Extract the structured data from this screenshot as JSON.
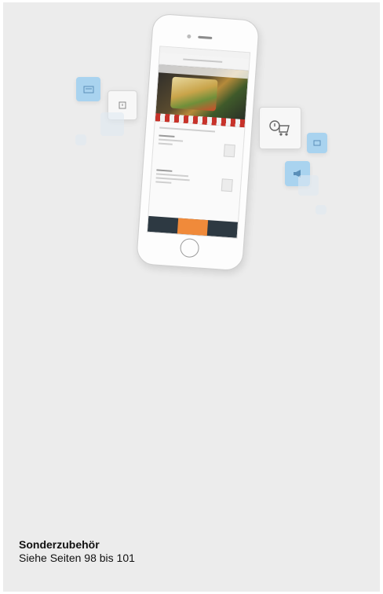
{
  "caption": {
    "title": "Sonderzubehör",
    "subtitle": "Siehe Seiten 98 bis 101"
  },
  "colors": {
    "page_bg": "#ececec",
    "tile_blue": "#a9d3ef",
    "tab_active": "#f08a3a",
    "tab_bar": "#2d3942"
  },
  "icons": [
    "oven-icon",
    "timer-icon",
    "cart-icon",
    "search-icon",
    "megaphone-icon"
  ]
}
